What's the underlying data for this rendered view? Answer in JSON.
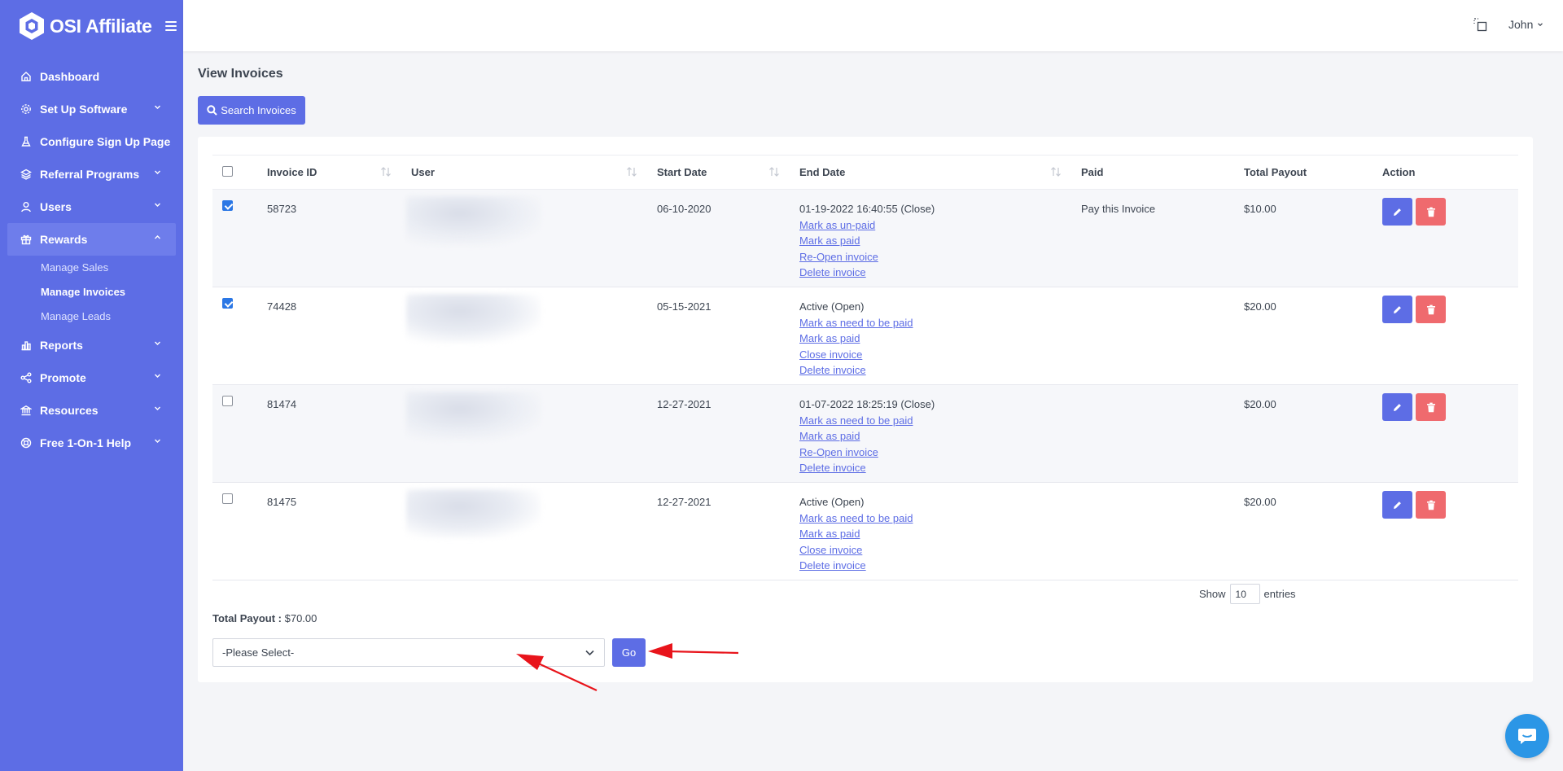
{
  "brand": {
    "name": "OSI Affiliate"
  },
  "sidebar": {
    "items": [
      {
        "label": "Dashboard",
        "icon": "home-icon"
      },
      {
        "label": "Set Up Software",
        "icon": "gear-icon",
        "chevron": "down"
      },
      {
        "label": "Configure Sign Up Page",
        "icon": "flask-icon"
      },
      {
        "label": "Referral Programs",
        "icon": "layers-icon",
        "chevron": "down"
      },
      {
        "label": "Users",
        "icon": "user-icon",
        "chevron": "down"
      },
      {
        "label": "Rewards",
        "icon": "gift-icon",
        "chevron": "up",
        "active": true
      },
      {
        "label": "Reports",
        "icon": "bar-chart-icon",
        "chevron": "down"
      },
      {
        "label": "Promote",
        "icon": "share-icon",
        "chevron": "down"
      },
      {
        "label": "Resources",
        "icon": "bank-icon",
        "chevron": "down"
      },
      {
        "label": "Free 1-On-1 Help",
        "icon": "lifebuoy-icon",
        "chevron": "down"
      }
    ],
    "rewards_sub": [
      {
        "label": "Manage Sales"
      },
      {
        "label": "Manage Invoices",
        "active": true
      },
      {
        "label": "Manage Leads"
      }
    ]
  },
  "topbar": {
    "user_name": "John"
  },
  "page": {
    "title": "View Invoices",
    "search_button": "Search Invoices"
  },
  "table": {
    "headers": {
      "invoice_id": "Invoice ID",
      "user": "User",
      "start_date": "Start Date",
      "end_date": "End Date",
      "paid": "Paid",
      "total_payout": "Total Payout",
      "action": "Action"
    },
    "rows": [
      {
        "checked": true,
        "invoice_id": "58723",
        "start_date": "06-10-2020",
        "end_date": "01-19-2022 16:40:55 (Close)",
        "links": [
          "Mark as un-paid",
          "Mark as paid",
          "Re-Open invoice",
          "Delete invoice"
        ],
        "paid": "Pay this Invoice",
        "total_payout": "$10.00"
      },
      {
        "checked": true,
        "invoice_id": "74428",
        "start_date": "05-15-2021",
        "end_date": "Active (Open)",
        "links": [
          "Mark as need to be paid",
          "Mark as paid",
          "Close invoice",
          "Delete invoice"
        ],
        "paid": "",
        "total_payout": "$20.00"
      },
      {
        "checked": false,
        "invoice_id": "81474",
        "start_date": "12-27-2021",
        "end_date": "01-07-2022 18:25:19 (Close)",
        "links": [
          "Mark as need to be paid",
          "Mark as paid",
          "Re-Open invoice",
          "Delete invoice"
        ],
        "paid": "",
        "total_payout": "$20.00"
      },
      {
        "checked": false,
        "invoice_id": "81475",
        "start_date": "12-27-2021",
        "end_date": "Active (Open)",
        "links": [
          "Mark as need to be paid",
          "Mark as paid",
          "Close invoice",
          "Delete invoice"
        ],
        "paid": "",
        "total_payout": "$20.00"
      }
    ]
  },
  "show_entries": {
    "prefix": "Show",
    "value": "10",
    "suffix": "entries"
  },
  "total": {
    "label": "Total Payout :",
    "value": "$70.00"
  },
  "bulk_action": {
    "selected": "-Please Select-",
    "go_button": "Go"
  },
  "colors": {
    "primary": "#5d6de5",
    "danger": "#ef6a6e",
    "annotation_arrow": "#e8141b",
    "chat": "#2b96e6"
  }
}
